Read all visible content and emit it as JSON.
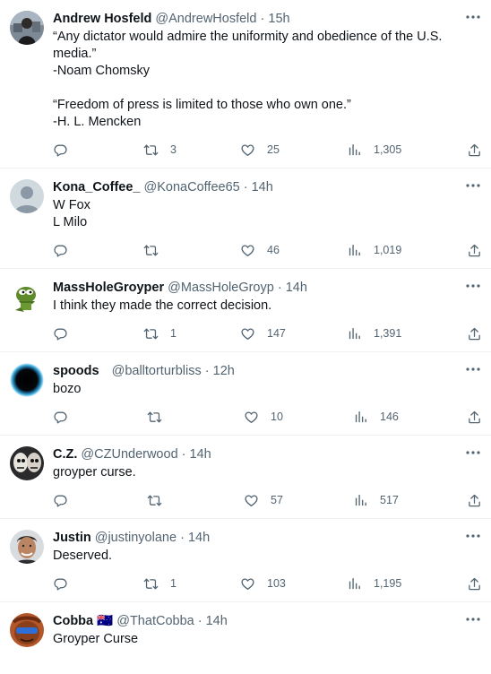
{
  "tweets": [
    {
      "name": "Andrew Hosfeld",
      "handle": "@AndrewHosfeld",
      "time": "15h",
      "text": "“Any dictator would admire the uniformity and obedience of the U.S. media.”\n-Noam Chomsky\n\n“Freedom of press is limited to those who own one.”\n-H. L. Mencken",
      "retweets": "3",
      "likes": "25",
      "views": "1,305"
    },
    {
      "name": "Kona_Coffee_",
      "handle": "@KonaCoffee65",
      "time": "14h",
      "text": "W Fox\nL Milo",
      "retweets": "",
      "likes": "46",
      "views": "1,019"
    },
    {
      "name": "MassHoleGroyper",
      "handle": "@MassHoleGroyp",
      "time": "14h",
      "text": "I think they made the correct decision.",
      "retweets": "1",
      "likes": "147",
      "views": "1,391"
    },
    {
      "name": "spoods",
      "handle": "@balltorturbliss",
      "time": "12h",
      "text": "bozo",
      "retweets": "",
      "likes": "10",
      "views": "146"
    },
    {
      "name": "C.Z.",
      "handle": "@CZUnderwood",
      "time": "14h",
      "text": "groyper curse.",
      "retweets": "",
      "likes": "57",
      "views": "517"
    },
    {
      "name": "Justin",
      "handle": "@justinyolane",
      "time": "14h",
      "text": "Deserved.",
      "retweets": "1",
      "likes": "103",
      "views": "1,195"
    },
    {
      "name": "Cobba",
      "flag": "🇦🇺",
      "handle": "@ThatCobba",
      "time": "14h",
      "text": "Groyper Curse"
    }
  ],
  "separator": "·",
  "icons": {
    "more": "more-horizontal-icon",
    "reply": "reply-icon",
    "retweet": "retweet-icon",
    "like": "heart-icon",
    "views": "views-chart-icon",
    "share": "share-icon"
  },
  "colors": {
    "text": "#0f1419",
    "secondary": "#536471",
    "divider": "#eff3f4"
  }
}
